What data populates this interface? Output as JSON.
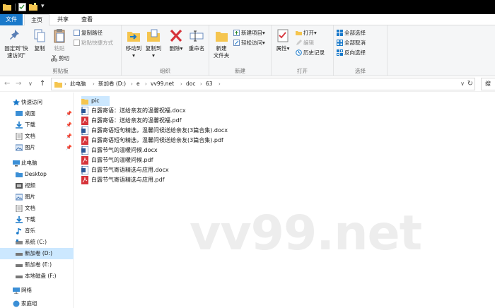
{
  "window": {
    "quick_access_dropdown": "▾"
  },
  "tabs": [
    {
      "label": "文件"
    },
    {
      "label": "主页"
    },
    {
      "label": "共享"
    },
    {
      "label": "查看"
    }
  ],
  "ribbon": {
    "clipboard": {
      "group_label": "剪贴板",
      "pin_label_1": "固定到\"快",
      "pin_label_2": "速访问\"",
      "copy_label": "复制",
      "paste_label": "粘贴",
      "copy_path_label": "复制路径",
      "paste_shortcut_label": "粘贴快捷方式",
      "cut_label": "剪切"
    },
    "organize": {
      "group_label": "组织",
      "move_to_label": "移动到",
      "copy_to_label": "复制到",
      "delete_label": "删除",
      "rename_label": "重命名"
    },
    "new": {
      "group_label": "新建",
      "new_folder_label_1": "新建",
      "new_folder_label_2": "文件夹",
      "new_item_label": "新建项目",
      "easy_access_label": "轻松访问"
    },
    "open": {
      "group_label": "打开",
      "properties_label": "属性",
      "open_label": "打开",
      "edit_label": "编辑",
      "history_label": "历史记录"
    },
    "select": {
      "group_label": "选择",
      "select_all_label": "全部选择",
      "select_none_label": "全部取消",
      "invert_label": "反向选择"
    },
    "dropdown_arrow": "▾"
  },
  "address": {
    "back": "←",
    "forward": "→",
    "recent": "∨",
    "up": "↑",
    "crumbs": [
      "此电脑",
      "新加卷 (D:)",
      "e",
      "vv99.net",
      "doc",
      "63"
    ],
    "separator": "›",
    "dropdown": "∨",
    "refresh": "↻",
    "search_glyph": "搜"
  },
  "nav": {
    "pin_glyph": "📌",
    "items": [
      {
        "label": "快速访问"
      },
      {
        "label": "桌面"
      },
      {
        "label": "下载"
      },
      {
        "label": "文档"
      },
      {
        "label": "图片"
      },
      {
        "label": "此电脑"
      },
      {
        "label": "Desktop"
      },
      {
        "label": "视频"
      },
      {
        "label": "图片"
      },
      {
        "label": "文档"
      },
      {
        "label": "下载"
      },
      {
        "label": "音乐"
      },
      {
        "label": "系统 (C:)"
      },
      {
        "label": "新加卷 (D:)"
      },
      {
        "label": "新加卷 (E:)"
      },
      {
        "label": "本地磁盘 (F:)"
      },
      {
        "label": "网络"
      },
      {
        "label": "家庭组"
      }
    ]
  },
  "files": [
    {
      "name": "pic",
      "kind": "folder"
    },
    {
      "name": "白露寄语：送给亲友的温馨祝福.docx",
      "kind": "docx"
    },
    {
      "name": "白露寄语：送给亲友的温馨祝福.pdf",
      "kind": "pdf"
    },
    {
      "name": "白露寄语短句精选，温馨问候送给亲友(3篇合集).docx",
      "kind": "docx"
    },
    {
      "name": "白露寄语短句精选，温馨问候送给亲友(3篇合集).pdf",
      "kind": "pdf"
    },
    {
      "name": "白露节气的温暖问候.docx",
      "kind": "docx"
    },
    {
      "name": "白露节气的温暖问候.pdf",
      "kind": "pdf"
    },
    {
      "name": "白露节气寄语精选与应用.docx",
      "kind": "docx"
    },
    {
      "name": "白露节气寄语精选与应用.pdf",
      "kind": "pdf"
    }
  ],
  "watermark": "vv99.net",
  "colors": {
    "accent": "#1979ca",
    "selection": "#cce8ff",
    "folder": "#f5c54f",
    "pdf": "#d6333a",
    "docx": "#2b5797"
  }
}
